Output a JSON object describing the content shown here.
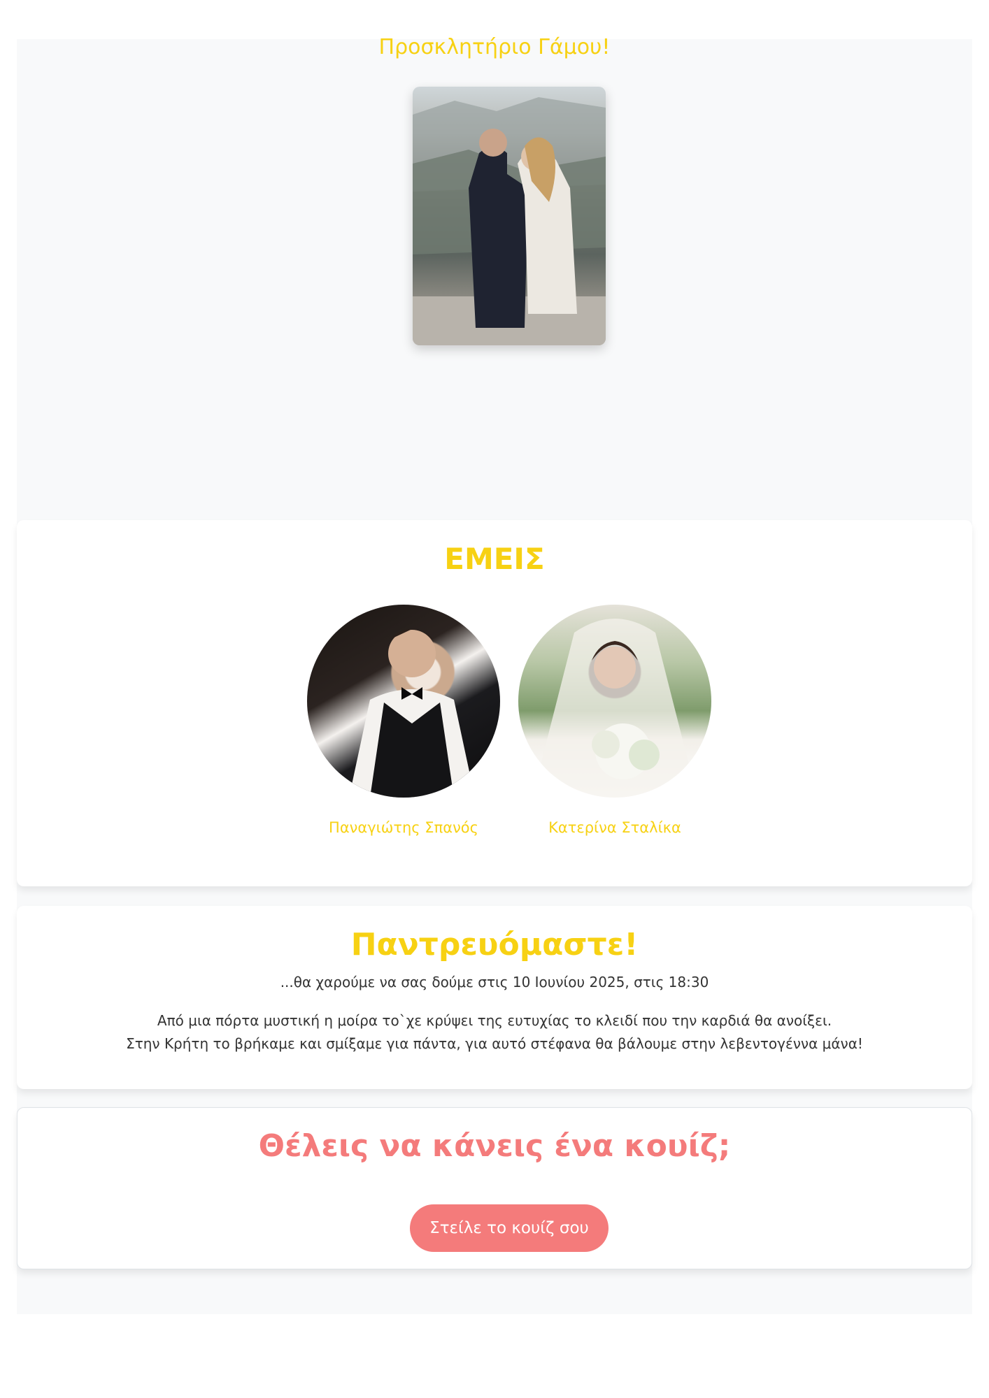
{
  "hero": {
    "title": "Προσκλητήριο Γάμου!"
  },
  "about": {
    "title": "ΕΜΕΙΣ",
    "groom_name": "Παναγιώτης Σπανός",
    "bride_name": "Κατερίνα Σταλίκα"
  },
  "announcement": {
    "title": "Παντρευόμαστε!",
    "subtitle": "...θα χαρούμε να σας δούμε στις 10 Ιουνίου 2025, στις 18:30",
    "poem_line_1": "Από μια πόρτα μυστική η μοίρα το`χε κρύψει της ευτυχίας το κλειδί που την καρδιά θα ανοίξει.",
    "poem_line_2": "Στην Κρήτη το βρήκαμε και σμίξαμε για πάντα, για αυτό στέφανα θα βάλουμε στην λεβεντογέννα μάνα!"
  },
  "quiz": {
    "title": "Θέλεις να κάνεις ένα κουίζ;",
    "button_label": "Στείλε το κουίζ σου"
  },
  "colors": {
    "accent_yellow": "#f7d113",
    "accent_coral": "#f47b7b",
    "body_text": "#333333",
    "page_bg": "#f8f9fa"
  }
}
